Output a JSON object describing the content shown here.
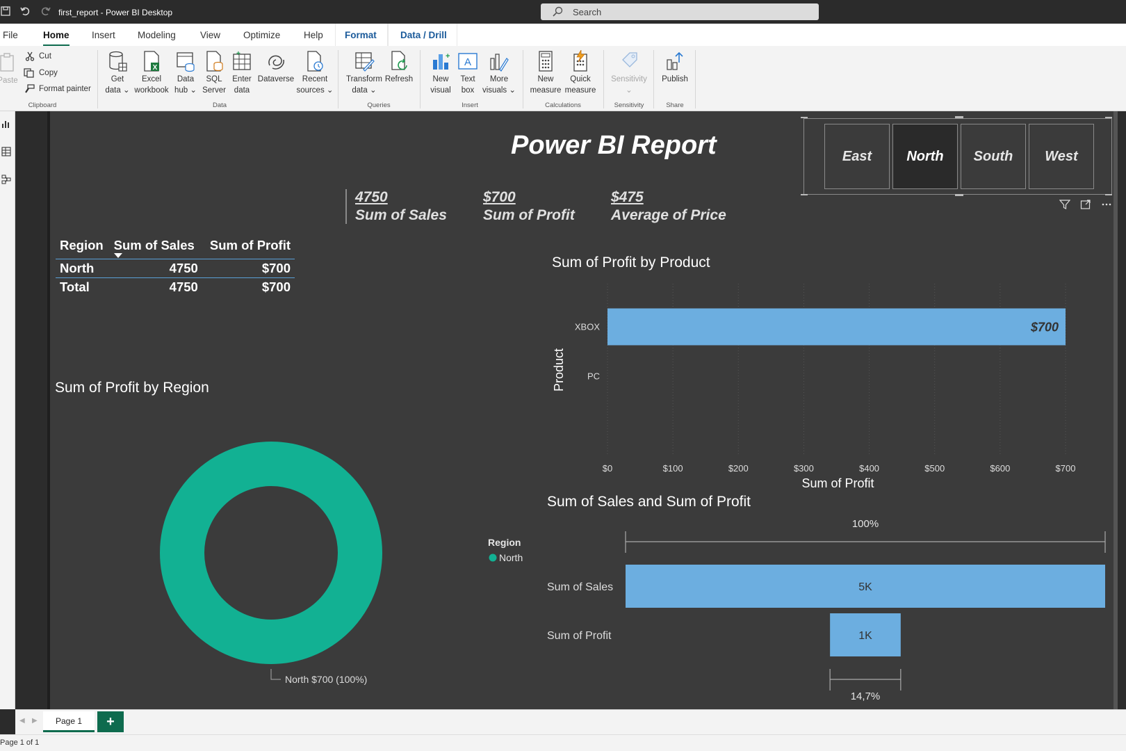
{
  "window": {
    "title": "first_report - Power BI Desktop"
  },
  "search": {
    "placeholder": "Search"
  },
  "menu": {
    "items": [
      "File",
      "Home",
      "Insert",
      "Modeling",
      "View",
      "Optimize",
      "Help",
      "Format",
      "Data / Drill"
    ],
    "active": "Home"
  },
  "ribbon": {
    "clipboard": {
      "paste": "Paste",
      "cut": "Cut",
      "copy": "Copy",
      "format_painter": "Format painter",
      "group": "Clipboard"
    },
    "data": {
      "get_data": [
        "Get",
        "data"
      ],
      "excel": [
        "Excel",
        "workbook"
      ],
      "data_hub": [
        "Data",
        "hub"
      ],
      "sql": [
        "SQL",
        "Server"
      ],
      "enter": [
        "Enter",
        "data"
      ],
      "dataverse": [
        "Dataverse"
      ],
      "recent": [
        "Recent",
        "sources"
      ],
      "group": "Data"
    },
    "queries": {
      "transform": [
        "Transform",
        "data"
      ],
      "refresh": [
        "Refresh"
      ],
      "group": "Queries"
    },
    "insert": {
      "new_visual": [
        "New",
        "visual"
      ],
      "text_box": [
        "Text",
        "box"
      ],
      "more_visuals": [
        "More",
        "visuals"
      ],
      "group": "Insert"
    },
    "calculations": {
      "new_measure": [
        "New",
        "measure"
      ],
      "quick_measure": [
        "Quick",
        "measure"
      ],
      "group": "Calculations"
    },
    "sensitivity": {
      "label": [
        "Sensitivity"
      ],
      "group": "Sensitivity"
    },
    "share": {
      "publish": [
        "Publish"
      ],
      "group": "Share"
    }
  },
  "report": {
    "title": "Power BI Report",
    "slicer": {
      "items": [
        "East",
        "North",
        "South",
        "West"
      ],
      "selected": "North"
    },
    "kpis": [
      {
        "value": "4750",
        "label": "Sum of Sales"
      },
      {
        "value": "$700",
        "label": "Sum of Profit"
      },
      {
        "value": "$475",
        "label": "Average of Price"
      }
    ],
    "table": {
      "headers": [
        "Region",
        "Sum of Sales",
        "Sum of Profit"
      ],
      "rows": [
        [
          "North",
          "4750",
          "$700"
        ]
      ],
      "total": [
        "Total",
        "4750",
        "$700"
      ]
    }
  },
  "chart_data": [
    {
      "type": "bar",
      "orientation": "horizontal",
      "title": "Sum of Profit by Product",
      "xlabel": "Sum of Profit",
      "ylabel": "Product",
      "categories": [
        "XBOX",
        "PC"
      ],
      "values": [
        700,
        0
      ],
      "data_labels": [
        "$700",
        ""
      ],
      "xlim": [
        0,
        700
      ],
      "xticks": [
        0,
        100,
        200,
        300,
        400,
        500,
        600,
        700
      ],
      "xtick_labels": [
        "$0",
        "$100",
        "$200",
        "$300",
        "$400",
        "$500",
        "$600",
        "$700"
      ],
      "grid": true,
      "bar_color": "#6caee0"
    },
    {
      "type": "pie",
      "subtype": "donut",
      "title": "Sum of Profit by Region",
      "legend_title": "Region",
      "legend_position": "right",
      "categories": [
        "North"
      ],
      "values": [
        700
      ],
      "data_labels": [
        "North $700 (100%)"
      ],
      "colors": [
        "#12b193"
      ]
    },
    {
      "type": "funnel",
      "title": "Sum of Sales and Sum of Profit",
      "categories": [
        "Sum of Sales",
        "Sum of Profit"
      ],
      "values": [
        4750,
        700
      ],
      "data_labels": [
        "5K",
        "1K"
      ],
      "top_percent_label": "100%",
      "bottom_percent_label": "14,7%",
      "bar_color": "#6caee0"
    }
  ],
  "tabs": {
    "pages": [
      "Page 1"
    ],
    "add": "+"
  },
  "status": {
    "text": "Page 1 of 1"
  }
}
